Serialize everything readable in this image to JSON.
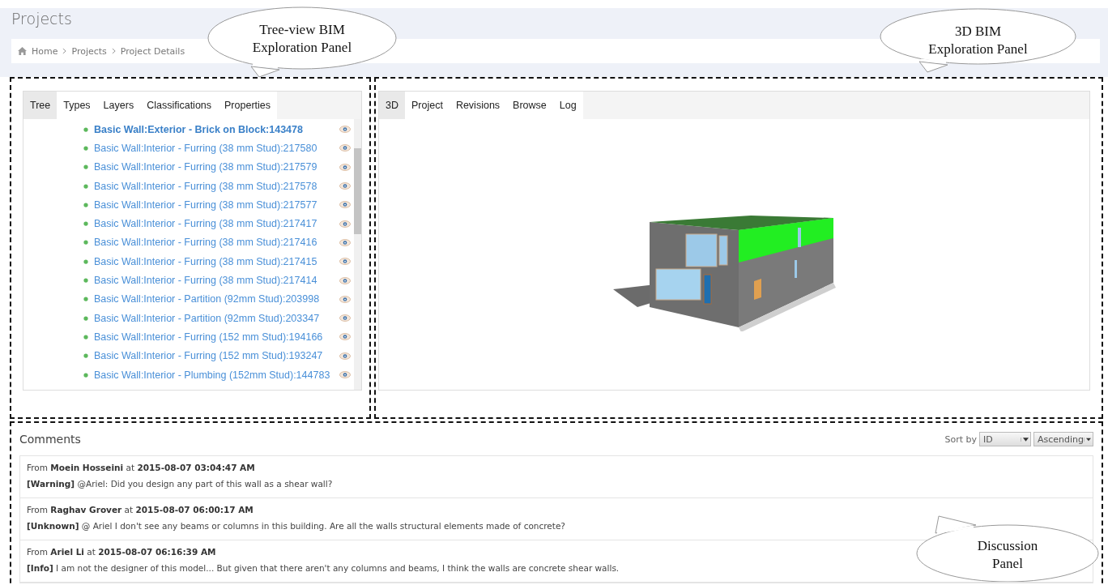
{
  "page": {
    "title": "Projects"
  },
  "breadcrumb": [
    "Home",
    "Projects",
    "Project Details"
  ],
  "tree_panel": {
    "tabs": [
      {
        "label": "Tree",
        "selected": true
      },
      {
        "label": "Types",
        "selected": false
      },
      {
        "label": "Layers",
        "selected": false
      },
      {
        "label": "Classifications",
        "selected": false
      },
      {
        "label": "Properties",
        "selected": false
      }
    ],
    "items": [
      {
        "label": "Basic Wall:Exterior - Brick on Block:143478",
        "selected": true
      },
      {
        "label": "Basic Wall:Interior - Furring (38 mm Stud):217580",
        "selected": false
      },
      {
        "label": "Basic Wall:Interior - Furring (38 mm Stud):217579",
        "selected": false
      },
      {
        "label": "Basic Wall:Interior - Furring (38 mm Stud):217578",
        "selected": false
      },
      {
        "label": "Basic Wall:Interior - Furring (38 mm Stud):217577",
        "selected": false
      },
      {
        "label": "Basic Wall:Interior - Furring (38 mm Stud):217417",
        "selected": false
      },
      {
        "label": "Basic Wall:Interior - Furring (38 mm Stud):217416",
        "selected": false
      },
      {
        "label": "Basic Wall:Interior - Furring (38 mm Stud):217415",
        "selected": false
      },
      {
        "label": "Basic Wall:Interior - Furring (38 mm Stud):217414",
        "selected": false
      },
      {
        "label": "Basic Wall:Interior - Partition (92mm Stud):203998",
        "selected": false
      },
      {
        "label": "Basic Wall:Interior - Partition (92mm Stud):203347",
        "selected": false
      },
      {
        "label": "Basic Wall:Interior - Furring (152 mm Stud):194166",
        "selected": false
      },
      {
        "label": "Basic Wall:Interior - Furring (152 mm Stud):193247",
        "selected": false
      },
      {
        "label": "Basic Wall:Interior - Plumbing (152mm Stud):144783",
        "selected": false
      }
    ]
  },
  "viewer_panel": {
    "tabs": [
      {
        "label": "3D",
        "selected": true
      },
      {
        "label": "Project",
        "selected": false
      },
      {
        "label": "Revisions",
        "selected": false
      },
      {
        "label": "Browse",
        "selected": false
      },
      {
        "label": "Log",
        "selected": false
      }
    ]
  },
  "comments": {
    "title": "Comments",
    "sort_label": "Sort by",
    "sort_field": "ID",
    "sort_order": "Ascending",
    "items": [
      {
        "header": "From **Moein Hosseini** at **2015-08-07 03:04:47 AM**",
        "body": "**[Warning]** @Ariel: Did you design any part of this wall as a shear wall?"
      },
      {
        "header": "From **Raghav Grover** at **2015-08-07 06:00:17 AM**",
        "body": "**[Unknown]** @ Ariel I don't see any beams or columns in this building. Are all the walls structural elements made of concrete?"
      },
      {
        "header": "From **Ariel Li** at **2015-08-07 06:16:39 AM**",
        "body": "**[Info]** I am not the designer of this model... But given that there aren't any columns and beams, I think the walls are concrete shear walls."
      }
    ]
  },
  "callouts": [
    {
      "lines": [
        "Tree-view BIM",
        "Exploration Panel"
      ]
    },
    {
      "lines": [
        "3D BIM",
        "Exploration Panel"
      ]
    },
    {
      "lines": [
        "Discussion",
        "Panel"
      ]
    }
  ]
}
